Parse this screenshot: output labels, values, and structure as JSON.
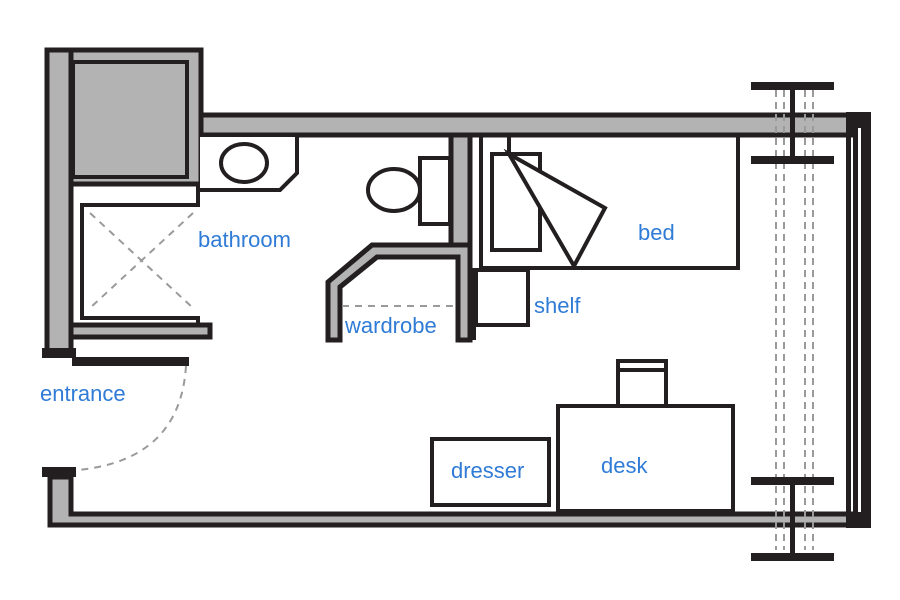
{
  "diagram": {
    "type": "floor-plan",
    "description": "Single dorm room floor plan",
    "colors": {
      "label": "#2f7bd6",
      "wall_fill": "#b3b3b3",
      "line": "#231f20",
      "dash": "#9a9a9a"
    },
    "labels": {
      "bathroom": "bathroom",
      "wardrobe": "wardrobe",
      "shelf": "shelf",
      "bed": "bed",
      "entrance": "entrance",
      "dresser": "dresser",
      "desk": "desk"
    }
  }
}
